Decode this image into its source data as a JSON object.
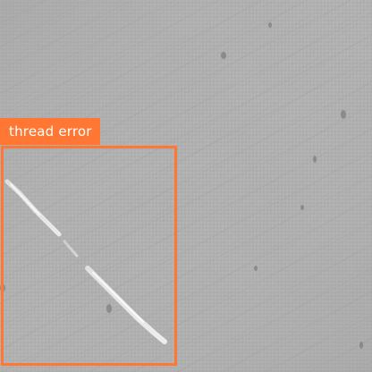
{
  "detection": {
    "label": "thread error",
    "color": "#ff7733"
  },
  "image": {
    "subject": "woven-fabric-texture",
    "tone": "#a9a9a9"
  }
}
